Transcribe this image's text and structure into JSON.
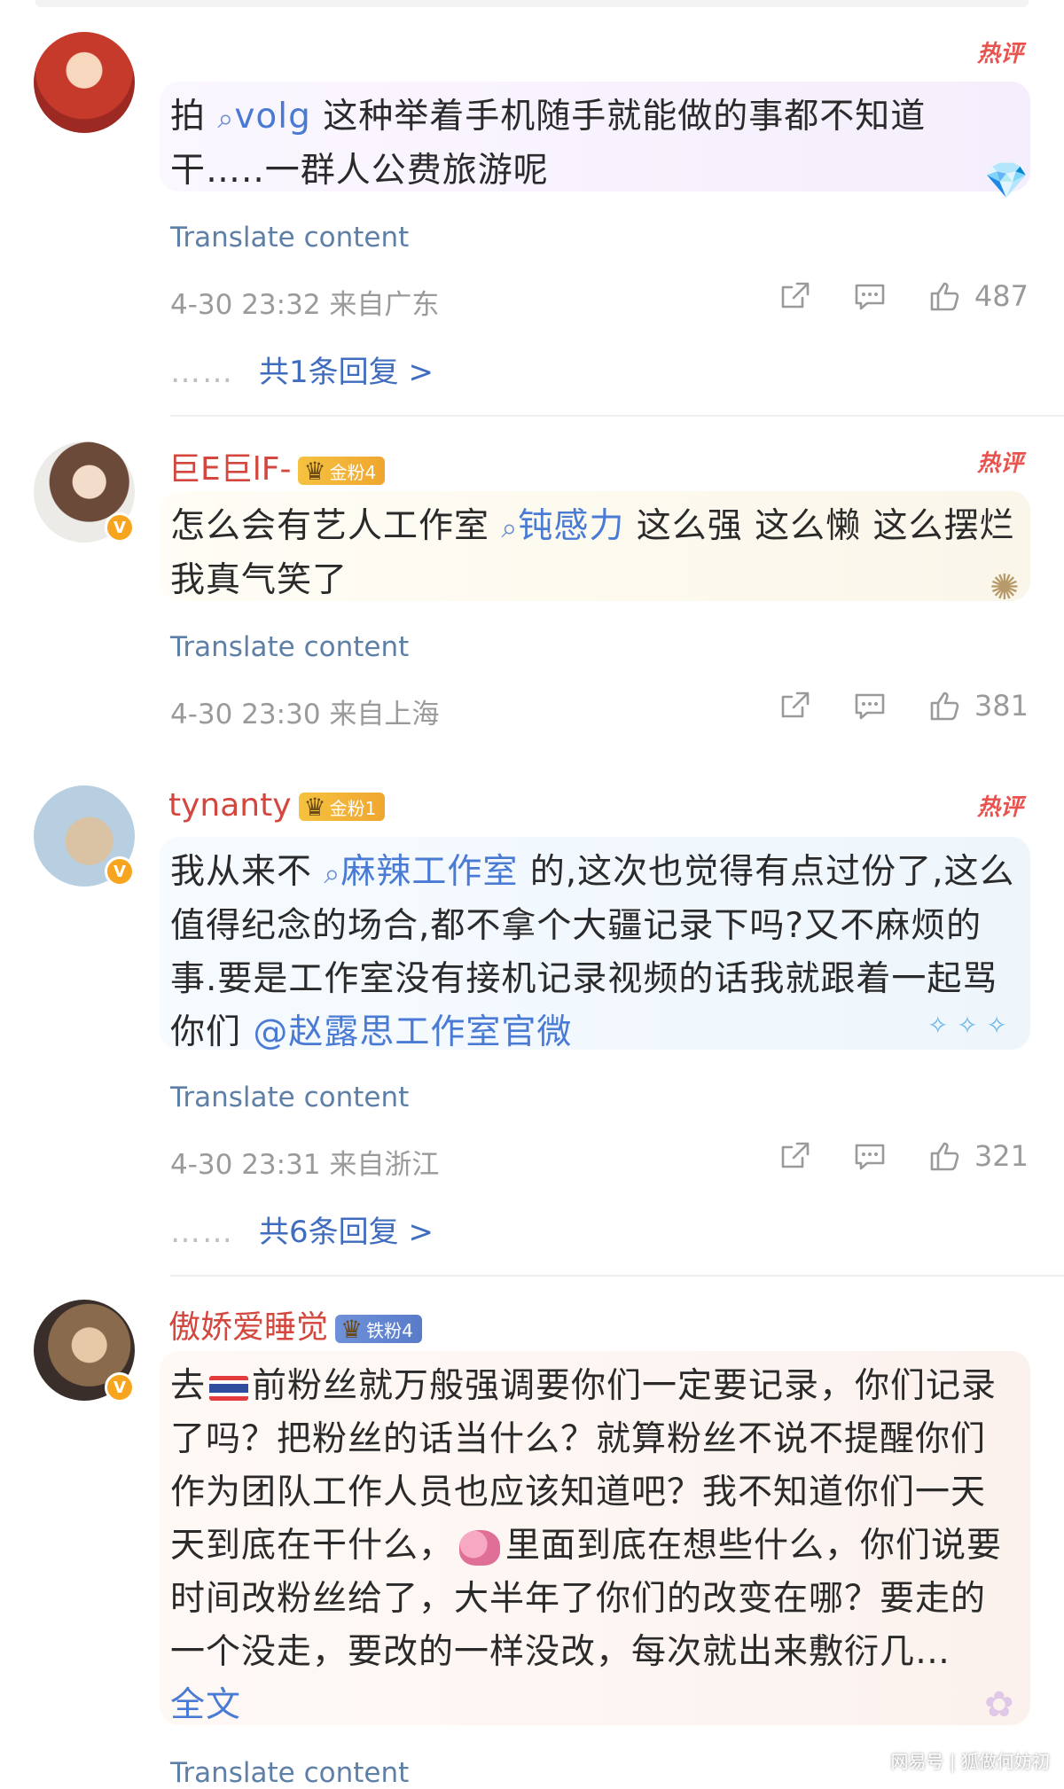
{
  "comments": [
    {
      "username": "",
      "hot_label": "热评",
      "text_parts": [
        "拍 ",
        "volg",
        " 这种举着手机随手就能做的事都不知道干…..一群人公费旅游呢"
      ],
      "translate": "Translate content",
      "time": "4-30 23:32",
      "location": "来自广东",
      "likes": "487",
      "replies": "共1条回复 >"
    },
    {
      "username": "巨E巨lF-",
      "fan_badge": "金粉4",
      "hot_label": "热评",
      "text_parts": [
        "怎么会有艺人工作室 ",
        "钝感力",
        " 这么强 这么懒 这么摆烂 我真气笑了"
      ],
      "translate": "Translate content",
      "time": "4-30 23:30",
      "location": "来自上海",
      "likes": "381"
    },
    {
      "username": "tynanty",
      "fan_badge": "金粉1",
      "hot_label": "热评",
      "text_parts": [
        "我从来不 ",
        "麻辣工作室",
        " 的,这次也觉得有点过份了,这么值得纪念的场合,都不拿个大疆记录下吗?又不麻烦的事.要是工作室没有接机记录视频的话我就跟着一起骂你们 ",
        "@赵露思工作室官微"
      ],
      "translate": "Translate content",
      "time": "4-30 23:31",
      "location": "来自浙江",
      "likes": "321",
      "replies": "共6条回复 >"
    },
    {
      "username": "傲娇爱睡觉",
      "fan_badge": "铁粉4",
      "text_parts": [
        "去",
        "前粉丝就万般强调要你们一定要记录，你们记录了吗？把粉丝的话当什么？就算粉丝不说不提醒你们作为团队工作人员也应该知道吧？我不知道你们一天天到底在干什么，",
        "里面到底在想些什么，你们说要时间改粉丝给了，大半年了你们的改变在哪？要走的一个没走，要改的一样没改，每次就出来敷衍几…"
      ],
      "full_text_link": "全文",
      "translate": "Translate content"
    }
  ],
  "watermark": "网易号 | 狐做何妨初",
  "icons": [
    "share-icon",
    "comment-icon",
    "like-icon",
    "search-icon",
    "flag-thailand-icon",
    "brain-icon",
    "crown-icon"
  ]
}
